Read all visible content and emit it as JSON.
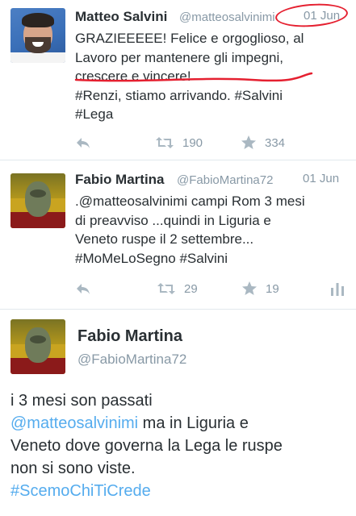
{
  "tweets": [
    {
      "name": "Matteo Salvini",
      "handle": "@matteosalvinimi",
      "date": "01 Jun",
      "lines": [
        "GRAZIEEEEE! Felice e orgoglioso, al",
        "Lavoro per mantenere gli impegni,",
        "crescere e vincere!",
        "#Renzi, stiamo arrivando. #Salvini",
        "#Lega"
      ],
      "retweets": "190",
      "favorites": "334"
    },
    {
      "name": "Fabio Martina",
      "handle": "@FabioMartina72",
      "date": "01 Jun",
      "lines": [
        ".@matteosalvinimi campi Rom 3 mesi",
        "di preavviso ...quindi in Liguria e",
        "Veneto ruspe il 2 settembre...",
        "#MoMeLoSegno #Salvini"
      ],
      "retweets": "29",
      "favorites": "19"
    },
    {
      "name": "Fabio Martina",
      "handle": "@FabioMartina72",
      "line1": "i 3 mesi son passati",
      "mention": "@matteosalvinimi",
      "line2_rest": " ma in Liguria e",
      "line3": "Veneto dove governa la Lega le ruspe",
      "line4": "non si sono viste.",
      "hashtag": "#ScemoChiTiCrede"
    }
  ],
  "icons": {
    "reply": "reply-icon",
    "retweet": "retweet-icon",
    "favorite": "star-icon",
    "stats": "stats-icon"
  },
  "colors": {
    "text": "#292f33",
    "secondary": "#8899a6",
    "icon": "#aab8c2",
    "link": "#55acee",
    "annotation": "#e52030"
  }
}
